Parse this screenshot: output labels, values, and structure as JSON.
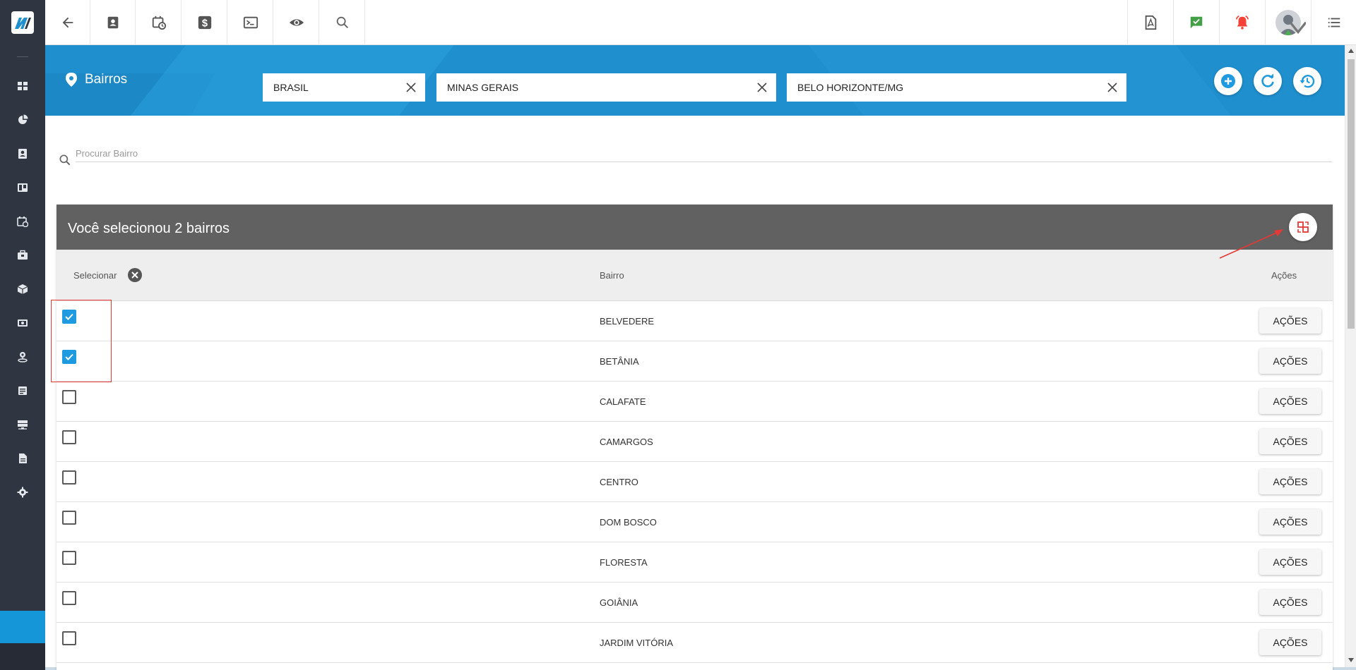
{
  "topbar": {
    "left_icons": [
      "back-arrow-icon",
      "contact-card-icon",
      "calendar-clock-icon",
      "dollar-icon",
      "terminal-icon",
      "eye-icon",
      "search-icon"
    ],
    "right_icons": [
      "pdf-icon",
      "chat-check-icon",
      "alarm-bell-icon",
      "user-avatar",
      "list-menu-icon"
    ],
    "colors": {
      "chat": "#43a047",
      "bell": "#f44336"
    }
  },
  "sidebar": {
    "icons": [
      "dashboard-icon",
      "pie-chart-icon",
      "contact-icon",
      "board-icon",
      "calendar-icon",
      "briefcase-icon",
      "package-icon",
      "money-icon",
      "map-person-icon",
      "document-icon",
      "server-icon",
      "file-icon",
      "settings-icon"
    ]
  },
  "header": {
    "title": "Bairros",
    "filters": [
      "BRASIL",
      "MINAS GERAIS",
      "BELO HORIZONTE/MG"
    ],
    "accent": "#1f8fce"
  },
  "search": {
    "placeholder": "Procurar Bairro"
  },
  "selection": {
    "title": "Você selecionou 2 bairros",
    "col_select": "Selecionar",
    "col_bairro": "Bairro",
    "col_acoes": "Ações"
  },
  "rows": [
    {
      "name": "BELVEDERE",
      "checked": true,
      "action": "AÇÕES"
    },
    {
      "name": "BETÂNIA",
      "checked": true,
      "action": "AÇÕES"
    },
    {
      "name": "CALAFATE",
      "checked": false,
      "action": "AÇÕES"
    },
    {
      "name": "CAMARGOS",
      "checked": false,
      "action": "AÇÕES"
    },
    {
      "name": "CENTRO",
      "checked": false,
      "action": "AÇÕES"
    },
    {
      "name": "DOM BOSCO",
      "checked": false,
      "action": "AÇÕES"
    },
    {
      "name": "FLORESTA",
      "checked": false,
      "action": "AÇÕES"
    },
    {
      "name": "GOIÂNIA",
      "checked": false,
      "action": "AÇÕES"
    },
    {
      "name": "JARDIM VITÓRIA",
      "checked": false,
      "action": "AÇÕES"
    }
  ]
}
